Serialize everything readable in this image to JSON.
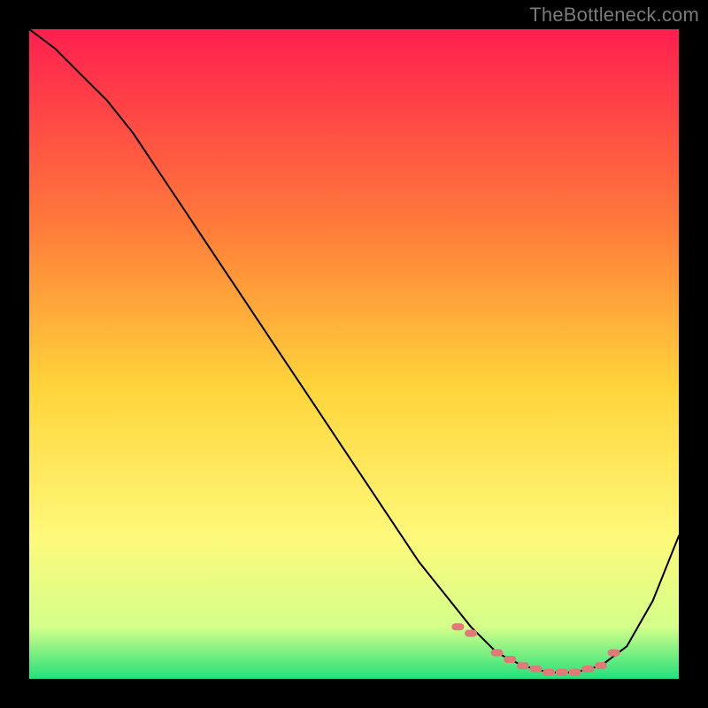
{
  "watermark": "TheBottleneck.com",
  "colors": {
    "background": "#000000",
    "line": "#000000",
    "marker": "#e07a78",
    "gradient_top": "#ff1f4f",
    "gradient_mid_upper": "#ff7a3a",
    "gradient_mid": "#ffd43a",
    "gradient_mid_lower": "#fff97a",
    "gradient_bottom_upper": "#d4ff8a",
    "gradient_bottom": "#24e07a"
  },
  "chart_data": {
    "type": "line",
    "title": "",
    "xlabel": "",
    "ylabel": "",
    "xlim": [
      0,
      100
    ],
    "ylim": [
      0,
      100
    ],
    "grid": false,
    "legend": false,
    "series": [
      {
        "name": "curve",
        "x": [
          0,
          4,
          8,
          12,
          16,
          20,
          24,
          28,
          32,
          36,
          40,
          44,
          48,
          52,
          56,
          60,
          64,
          68,
          72,
          76,
          80,
          84,
          88,
          92,
          96,
          100
        ],
        "y": [
          100,
          97,
          93,
          89,
          84,
          78,
          72,
          66,
          60,
          54,
          48,
          42,
          36,
          30,
          24,
          18,
          13,
          8,
          4,
          2,
          1,
          1,
          2,
          5,
          12,
          22
        ]
      }
    ],
    "markers": {
      "name": "highlighted-points",
      "x": [
        66,
        68,
        72,
        74,
        76,
        78,
        80,
        82,
        84,
        86,
        88,
        90
      ],
      "y": [
        8,
        7,
        4,
        3,
        2,
        1.5,
        1,
        1,
        1,
        1.5,
        2,
        4
      ]
    }
  }
}
